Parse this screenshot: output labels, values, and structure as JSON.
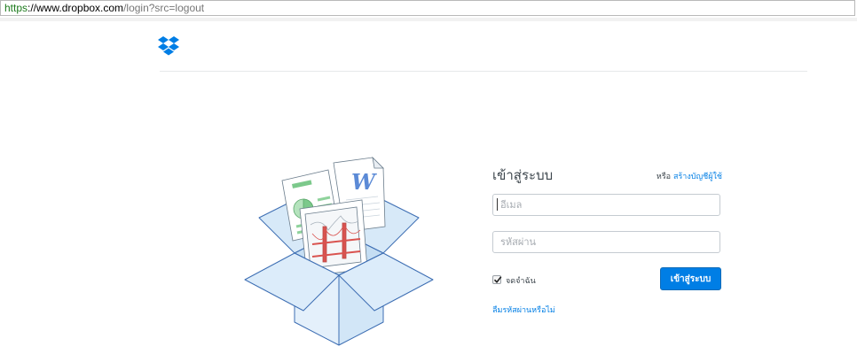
{
  "browser": {
    "url_scheme": "https",
    "url_host": "://www.dropbox.com",
    "url_path": "/login?src=logout"
  },
  "header": {
    "logo_icon": "dropbox-logo-icon"
  },
  "illustration": {
    "icon": "open-box-with-documents-illustration"
  },
  "login": {
    "title": "เข้าสู่ระบบ",
    "or_text": "หรือ",
    "signup_link": "สร้างบัญชีผู้ใช้",
    "email_placeholder": "อีเมล",
    "password_placeholder": "รหัสผ่าน",
    "remember_label": "จดจำฉัน",
    "remember_checked": true,
    "submit_label": "เข้าสู่ระบบ",
    "forgot_link": "ลืมรหัสผ่านหรือไม่"
  },
  "colors": {
    "accent": "#007ee5",
    "illustration_blue": "#d7e9f8",
    "illustration_stroke": "#3d6eb3"
  }
}
